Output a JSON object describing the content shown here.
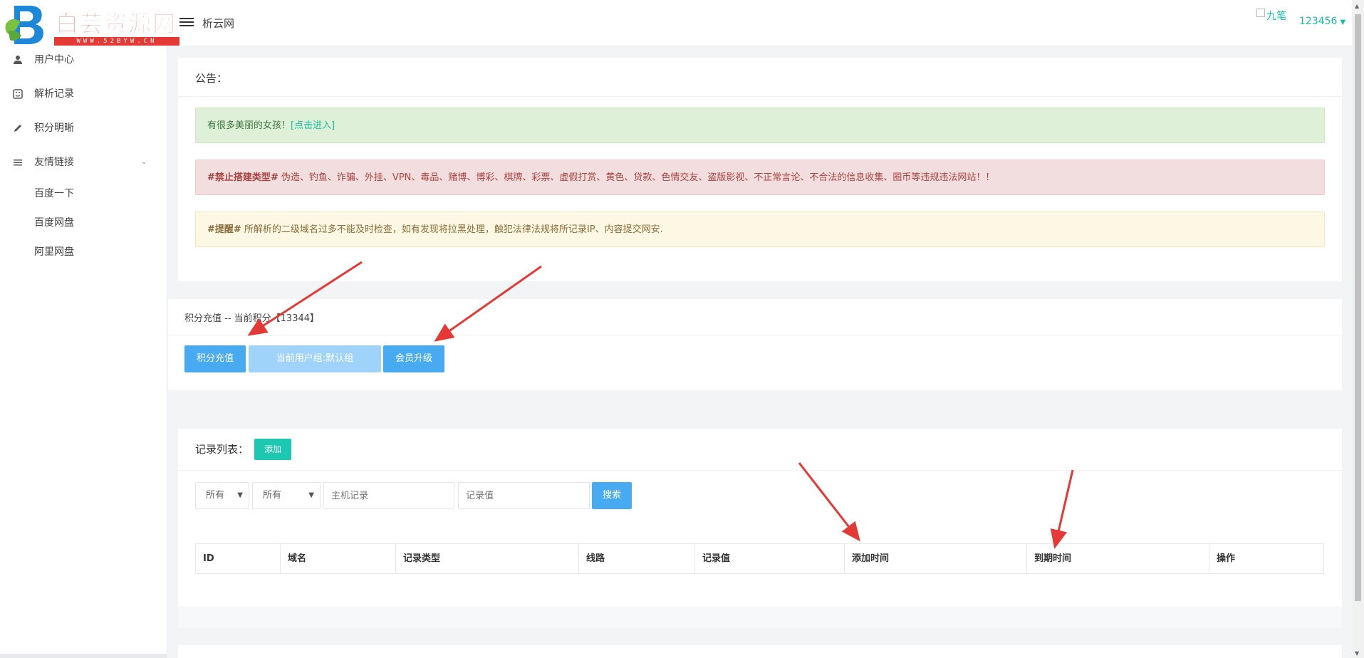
{
  "header": {
    "logo_text": "白芸资源网",
    "logo_sub": "WWW.52BYW.CN",
    "site_name": "析云网",
    "avatar_alt": "九笔",
    "username": "123456"
  },
  "sidebar": {
    "items": [
      {
        "label": "用户中心",
        "icon": "user-icon"
      },
      {
        "label": "解析记录",
        "icon": "record-icon"
      },
      {
        "label": "积分明晰",
        "icon": "pencil-icon"
      },
      {
        "label": "友情链接",
        "icon": "list-icon"
      }
    ],
    "links": [
      "百度一下",
      "百度网盘",
      "阿里网盘"
    ]
  },
  "notice": {
    "title": "公告：",
    "green_text": "有很多美丽的女孩！",
    "green_link": "[点击进入]",
    "red_tag": "#禁止搭建类型#",
    "red_text": " 伪造、钓鱼、诈骗、外挂、VPN、毒品、赌博、博彩、棋牌、彩票、虚假打赏、黄色、贷款、色情交友、盗版影视、不正常言论、不合法的信息收集、圈币等违规违法网站！！",
    "yellow_tag": "#提醒#",
    "yellow_text": " 所解析的二级域名过多不能及时检查，如有发现将拉黑处理，触犯法律法规将所记录IP、内容提交网安."
  },
  "points": {
    "title": "积分充值 -- 当前积分【13344】",
    "recharge_button": "积分充值",
    "group_button": "当前用户组:默认组",
    "upgrade_button": "会员升级"
  },
  "records": {
    "title": "记录列表：",
    "add_button": "添加",
    "filter1": "所有",
    "filter2": "所有",
    "host_placeholder": "主机记录",
    "value_placeholder": "记录值",
    "search_button": "搜索",
    "columns": [
      "ID",
      "域名",
      "记录类型",
      "线路",
      "记录值",
      "添加时间",
      "到期时间",
      "操作"
    ]
  },
  "colors": {
    "accent": "#15c0a0",
    "button_blue": "#48aaf0",
    "arrow_red": "#e53935"
  }
}
